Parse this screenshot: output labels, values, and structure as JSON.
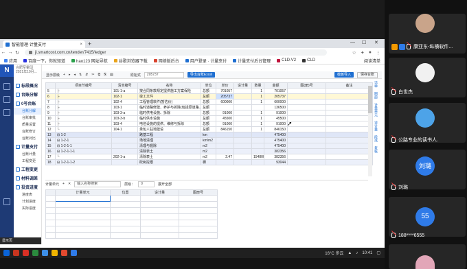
{
  "browser": {
    "tab_title": "智能管理·计量支付",
    "url": "ji.smartcost.com.cn/tender/7415/ledger",
    "bookmarks": [
      "应用",
      "百度一下，你就知道",
      "hao123 网址导航",
      "谷歌浏览器下载",
      "网络版后台",
      "用户登录 · 计量支付",
      "计量支付后台管理",
      "CLD.V2",
      "CLD"
    ],
    "reading_list": "阅读清单"
  },
  "app": {
    "logo": "N",
    "project_name": "合肥至霍邱 2021年10月...",
    "nav": [
      {
        "section": "标段概况",
        "items": []
      },
      {
        "section": "台账分解",
        "items": []
      },
      {
        "section": "0号台账",
        "items": [
          "台账分解",
          "台账审批",
          "质量设置",
          "台账修订",
          "台账对比"
        ]
      },
      {
        "section": "计量支付",
        "items": [
          "台账计量",
          "工程变更"
        ]
      },
      {
        "section": "工程变更",
        "items": []
      },
      {
        "section": "材料调差",
        "items": []
      },
      {
        "section": "投资进度",
        "items": [
          "进度表",
          "计划进度",
          "实际进度"
        ]
      }
    ],
    "bottom_tip": "显示页"
  },
  "toolbar": {
    "items": [
      "显示层级",
      "+",
      "▸",
      "◂",
      "⇅",
      "⇵",
      "✂",
      "⧉",
      "⎘",
      "▤"
    ],
    "search_label": "原始式",
    "search_value": "205737",
    "primary_button": "导出台账Excel",
    "right_button1": "模板导入",
    "right_button2": "保存台账"
  },
  "grid": {
    "headers": [
      "",
      "项目节编号",
      "清单编号",
      "名称",
      "单位",
      "单价",
      "设计量",
      "数量",
      "金额",
      "图(册)号",
      "备注"
    ],
    "group_header": "设计量",
    "rows": [
      {
        "no": "5",
        "code": "├",
        "bill": "101-1-a",
        "name": "按合同条款规定提供施工方案保险",
        "unit": "总额",
        "price": "701057",
        "qty": "1",
        "amt": "701057",
        "style": ""
      },
      {
        "no": "6",
        "code": "├",
        "bill": "102-1",
        "name": "竣工文件",
        "unit": "总额",
        "price": "205737",
        "qty": "1",
        "amt": "205737",
        "style": "yellow"
      },
      {
        "no": "7",
        "code": "├",
        "bill": "102-4",
        "name": "工程管理软件(暂估价)",
        "unit": "总额",
        "price": "600000",
        "qty": "1",
        "amt": "600000",
        "style": ""
      },
      {
        "no": "8",
        "code": "├",
        "bill": "103-1",
        "name": "临时道路修建、养护与拆除(包括原道路...)",
        "unit": "总额",
        "price": "",
        "qty": "",
        "amt": "136500",
        "style": ""
      },
      {
        "no": "9",
        "code": "├",
        "bill": "103-3-a",
        "name": "临时供电设施、拆除",
        "unit": "总额",
        "price": "91000",
        "qty": "1",
        "amt": "91000",
        "style": ""
      },
      {
        "no": "10",
        "code": "├",
        "bill": "103-3-b",
        "name": "临时供水设施",
        "unit": "总额",
        "price": "45500",
        "qty": "1",
        "amt": "45500",
        "style": ""
      },
      {
        "no": "11",
        "code": "├",
        "bill": "103-4",
        "name": "电信设施的提供、维修与拆除",
        "unit": "总额",
        "price": "91000",
        "qty": "1",
        "amt": "91000",
        "style": ""
      },
      {
        "no": "12",
        "code": "└",
        "bill": "104-1",
        "name": "承包人驻地建设",
        "unit": "总额",
        "price": "846150",
        "qty": "1",
        "amt": "846150",
        "style": ""
      },
      {
        "no": "13",
        "code": "⊟ 1-2",
        "bill": "",
        "name": "路基工程",
        "unit": "km",
        "price": "",
        "qty": "",
        "amt": "475400",
        "style": "blue"
      },
      {
        "no": "14",
        "code": "⊟ 1-2-1",
        "bill": "",
        "name": "场地清理",
        "unit": "km/m2",
        "price": "",
        "qty": "",
        "amt": "475400",
        "style": "blue2"
      },
      {
        "no": "15",
        "code": "⊟ 1-2-1-1",
        "bill": "",
        "name": "清理与掘除",
        "unit": "m2",
        "price": "",
        "qty": "",
        "amt": "475400",
        "style": "blue2"
      },
      {
        "no": "16",
        "code": "⊟ 1-2-1-1-1",
        "bill": "",
        "name": "清除表土",
        "unit": "m2",
        "price": "",
        "qty": "",
        "amt": "382356",
        "style": "blue2"
      },
      {
        "no": "17",
        "code": "└",
        "bill": "202-1-a",
        "name": "清除表土",
        "unit": "m2",
        "price": "2.47",
        "qty": "154800",
        "amt": "382356",
        "style": ""
      },
      {
        "no": "18",
        "code": "⊟ 1-2-1-1-2",
        "bill": "",
        "name": "砍树挖根",
        "unit": "棵",
        "price": "",
        "qty": "",
        "amt": "93044",
        "style": "blue2"
      }
    ]
  },
  "right_links": [
    "清单",
    "图册",
    "计量单元",
    "设计量",
    "段落",
    "复核"
  ],
  "calc": {
    "label": "计量单元",
    "placeholder": "输入名称搜索",
    "level_label": "层级：",
    "level_value": "0",
    "filter_label": "展开全部",
    "headers": [
      "计量单元",
      "位置",
      "设计量",
      "图册号"
    ]
  },
  "taskbar": {
    "weather": "16°C 多云",
    "time": "10:41",
    "date": "2021/10/..."
  },
  "meeting": {
    "participants": [
      {
        "name": "康亚东-纵横软件..."
      },
      {
        "name": "白世杰"
      },
      {
        "name": "公路专业的读书人."
      },
      {
        "name": "刘璐",
        "avatar_text": "刘璐",
        "color": "#2f7be8"
      },
      {
        "name": "188****6555",
        "avatar_text": "55",
        "color": "#2f7be8"
      }
    ]
  }
}
